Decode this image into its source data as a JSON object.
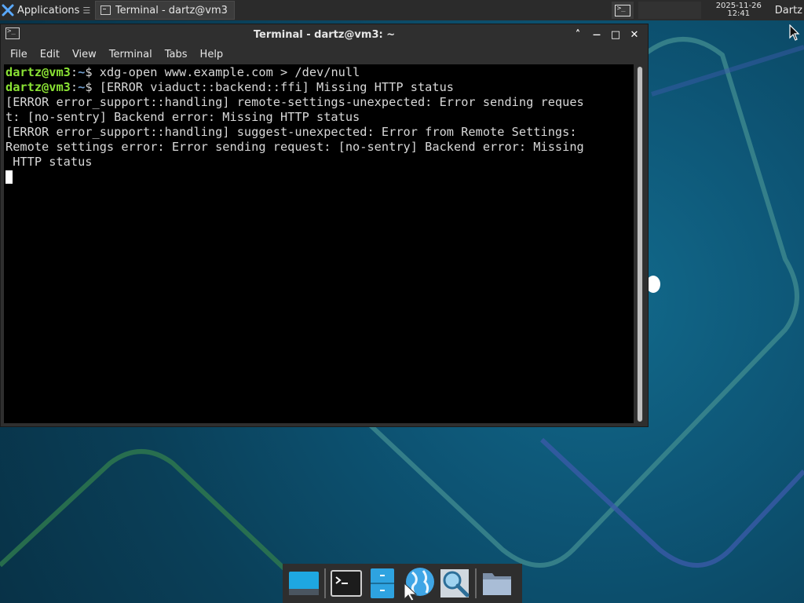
{
  "top_panel": {
    "applications_label": "Applications",
    "task_title": "Terminal - dartz@vm3: ~",
    "clock_date": "2025-11-26",
    "clock_time": "12:41",
    "user": "Dartz"
  },
  "window": {
    "title": "Terminal - dartz@vm3: ~",
    "controls": {
      "up": "˄",
      "minimize": "—",
      "maximize": "□",
      "close": "✕"
    },
    "menu": [
      "File",
      "Edit",
      "View",
      "Terminal",
      "Tabs",
      "Help"
    ]
  },
  "terminal": {
    "prompt_user": "dartz@vm3",
    "prompt_sep": ":",
    "prompt_path": "~",
    "prompt_symbol": "$ ",
    "command_1": "xdg-open www.example.com > /dev/null",
    "command_2": "[ERROR viaduct::backend::ffi] Missing HTTP status",
    "output": [
      "[ERROR error_support::handling] remote-settings-unexpected: Error sending reques",
      "t: [no-sentry] Backend error: Missing HTTP status",
      "[ERROR error_support::handling] suggest-unexpected: Error from Remote Settings:",
      "Remote settings error: Error sending request: [no-sentry] Backend error: Missing",
      " HTTP status"
    ]
  },
  "dock": {
    "items": [
      "show-desktop-icon",
      "terminal-icon",
      "file-manager-icon",
      "web-browser-icon",
      "app-finder-icon",
      "folder-icon"
    ]
  },
  "colors": {
    "prompt_user": "#8ae234",
    "prompt_path": "#729fcf",
    "desktop": "#0d5474"
  }
}
